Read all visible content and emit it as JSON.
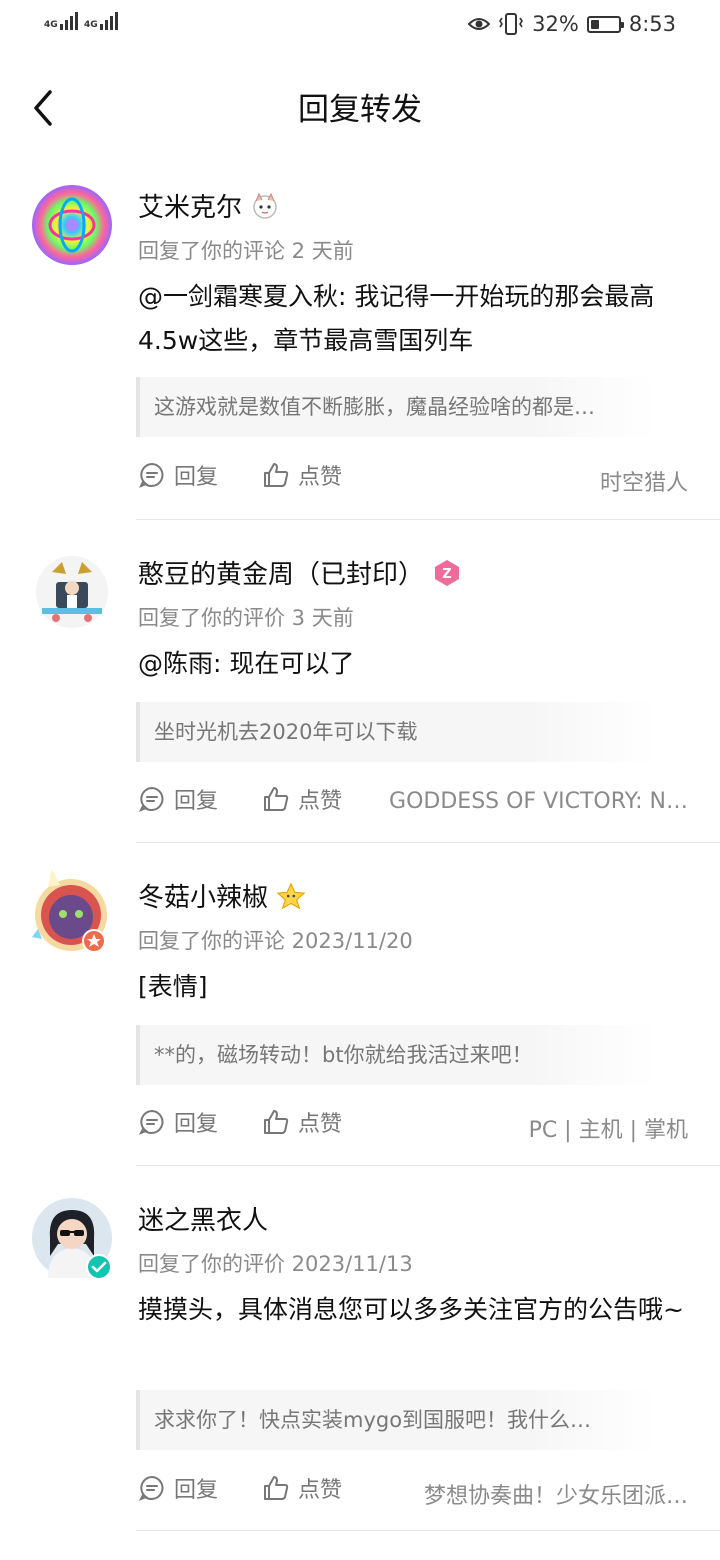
{
  "status_bar": {
    "sim1_label": "4G",
    "sim2_label": "4G",
    "battery_percent": "32%",
    "battery_level": 0.32,
    "time": "8:53",
    "icons": [
      "eye-icon",
      "vibrate-icon",
      "battery-icon"
    ]
  },
  "header": {
    "title": "回复转发",
    "back_icon": "chevron-left-icon"
  },
  "actions": {
    "reply_label": "回复",
    "like_label": "点赞"
  },
  "items": [
    {
      "username": "艾米克尔",
      "meta": "回复了你的评论 2 天前",
      "content": "@一剑霜寒夏入秋: 我记得一开始玩的那会最高4.5w这些，章节最高雪国列车",
      "quote": "这游戏就是数值不断膨胀，魔晶经验啥的都是…",
      "source": "时空猎人"
    },
    {
      "username": "憨豆的黄金周（已封印）",
      "meta": "回复了你的评价 3 天前",
      "content": "@陈雨: 现在可以了",
      "quote": "坐时光机去2020年可以下载",
      "source": "GODDESS OF VICTORY: N…"
    },
    {
      "username": "冬菇小辣椒",
      "meta": "回复了你的评论 2023/11/20",
      "content": "[表情]",
      "quote": "**的，磁场转动！bt你就给我活过来吧！",
      "source": "PC | 主机 | 掌机"
    },
    {
      "username": "迷之黑衣人",
      "meta": "回复了你的评价 2023/11/13",
      "content": "摸摸头，具体消息您可以多多关注官方的公告哦~",
      "quote": "求求你了！快点实装mygo到国服吧！我什么…",
      "source": "梦想协奏曲！少女乐团派…"
    }
  ]
}
